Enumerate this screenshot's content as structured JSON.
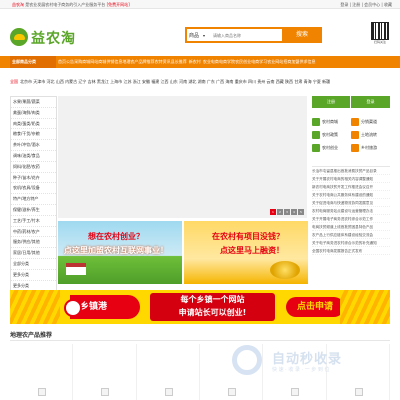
{
  "topbar": {
    "site": "益农淘",
    "tagline": "是农业发展农村电子商务的引入产业服务平台",
    "notice": "[免费开网站]",
    "links": "登录 | 注册 | 会员中心 | 收藏"
  },
  "header": {
    "logo_text": "益农淘",
    "search_category": "商品",
    "search_caret": "▾",
    "search_placeholder": "请输入商品名称",
    "search_button": "搜索",
    "qr_caption": "扫码关注"
  },
  "nav": {
    "all_label": "全部商品分类",
    "items": [
      "首页公告",
      "采购商城",
      "网站商城",
      "供销信息",
      "地理农产",
      "品牌推荐",
      "农特资讯",
      "县长推荐",
      "新农村",
      "农业电商",
      "电商学院",
      "农民创业",
      "电商学习",
      "农业网站",
      "招商加盟",
      "供求信息"
    ]
  },
  "regions": {
    "label": "全国",
    "list": "北京市 天津市 河北 山西 内蒙古 辽宁 吉林 黑龙江 上海市 江苏 浙江 安徽 福建 江西 山东 河南 湖北 湖南 广东 广西 海南 重庆市 四川 贵州 云南 西藏 陕西 甘肃 青海 宁夏 新疆"
  },
  "sidebar": {
    "items": [
      "水果/果蔬/蔬菜",
      "禽蛋/海鲜/肉类",
      "肉类/蛋类/奶类",
      "粮食/干货/杂粮",
      "茶叶/冲饮/酒水",
      "调味/油类/食品",
      "饲料/化肥/农药",
      "种子/苗木/花卉",
      "农机/农具/设备",
      "特产/地方特产",
      "保健/滋补/养生",
      "工艺/手工/竹木",
      "中药/药材/农产",
      "服务/供应/其他",
      "家居/日用/其他",
      "全部分类",
      "更多分类",
      "更多分类",
      "更多分类",
      "返回顶部"
    ]
  },
  "banner": {
    "dots": [
      "1",
      "2",
      "3",
      "4",
      "5"
    ]
  },
  "sub_banner_1": {
    "line1": "想在农村创业？",
    "line2": "点这里加盟农村互联网事业！"
  },
  "sub_banner_2": {
    "line1": "在农村有项目没钱？",
    "line2": "点这里马上融资！"
  },
  "right": {
    "tab1": "注册",
    "tab2": "登录",
    "links": [
      "农村商城",
      "分销渠道",
      "农村政策",
      "土地流转",
      "农村创业",
      "乡村旅游"
    ],
    "news": [
      "长治市屯留县推出首批消费扶贫产品目录",
      "关于开展农村电商的相关内容调整通知",
      "新农村电商扶贫开发工作推进会议召开",
      "关于农村电商公共服务体系建设的通知",
      "关于促进电商与快递物流协同发展意见",
      "农村电商服务站点建设与运营管理办法",
      "关于开展电子商务进农村综合示范工作",
      "电商扶贫频道上线首批贫困县特色产品",
      "农产品上行供应链体系建设经验交流会",
      "关于电子商务进农村综合示范的补充通知",
      "全国农村电商发展报告正式发布"
    ]
  },
  "wide_ad": {
    "brand": "乡镇港",
    "slogan_1": "每个乡镇一个网站",
    "slogan_2": "申请站长可以创业!",
    "cta": "点击申请"
  },
  "products": {
    "title": "地理农产品推荐"
  },
  "watermark": {
    "title": "自动秒收录",
    "subtitle": "快 速 · 收 录 · 一 步 到 位"
  }
}
